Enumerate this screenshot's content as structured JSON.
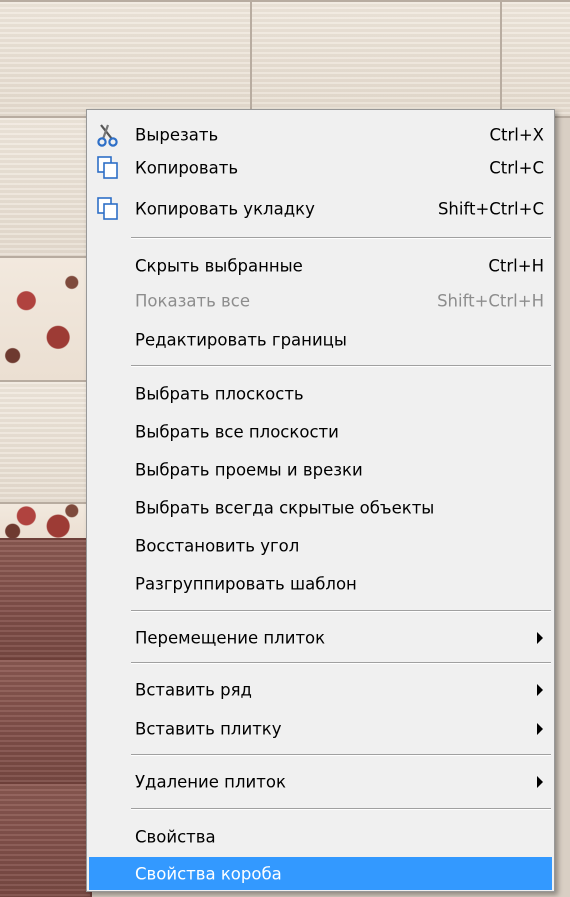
{
  "menu": {
    "items": [
      {
        "label": "Вырезать",
        "shortcut": "Ctrl+X",
        "icon": "scissors-icon"
      },
      {
        "label": "Копировать",
        "shortcut": "Ctrl+C",
        "icon": "copy-icon"
      },
      {
        "label": "Копировать укладку",
        "shortcut": "Shift+Ctrl+C",
        "icon": "copy-layout-icon"
      },
      {
        "label": "Скрыть выбранные",
        "shortcut": "Ctrl+H"
      },
      {
        "label": "Показать все",
        "shortcut": "Shift+Ctrl+H",
        "disabled": true
      },
      {
        "label": "Редактировать границы"
      },
      {
        "label": "Выбрать плоскость"
      },
      {
        "label": "Выбрать все плоскости"
      },
      {
        "label": "Выбрать проемы и врезки"
      },
      {
        "label": "Выбрать всегда скрытые объекты"
      },
      {
        "label": "Восстановить угол"
      },
      {
        "label": "Разгруппировать шаблон"
      },
      {
        "label": "Перемещение плиток",
        "submenu": true
      },
      {
        "label": "Вставить ряд",
        "submenu": true
      },
      {
        "label": "Вставить плитку",
        "submenu": true
      },
      {
        "label": "Удаление плиток",
        "submenu": true
      },
      {
        "label": "Свойства"
      },
      {
        "label": "Свойства короба",
        "selected": true
      }
    ]
  },
  "colors": {
    "highlight": "#3399ff",
    "menu_bg": "#f0f0f0",
    "disabled_text": "#8d8d8d"
  }
}
